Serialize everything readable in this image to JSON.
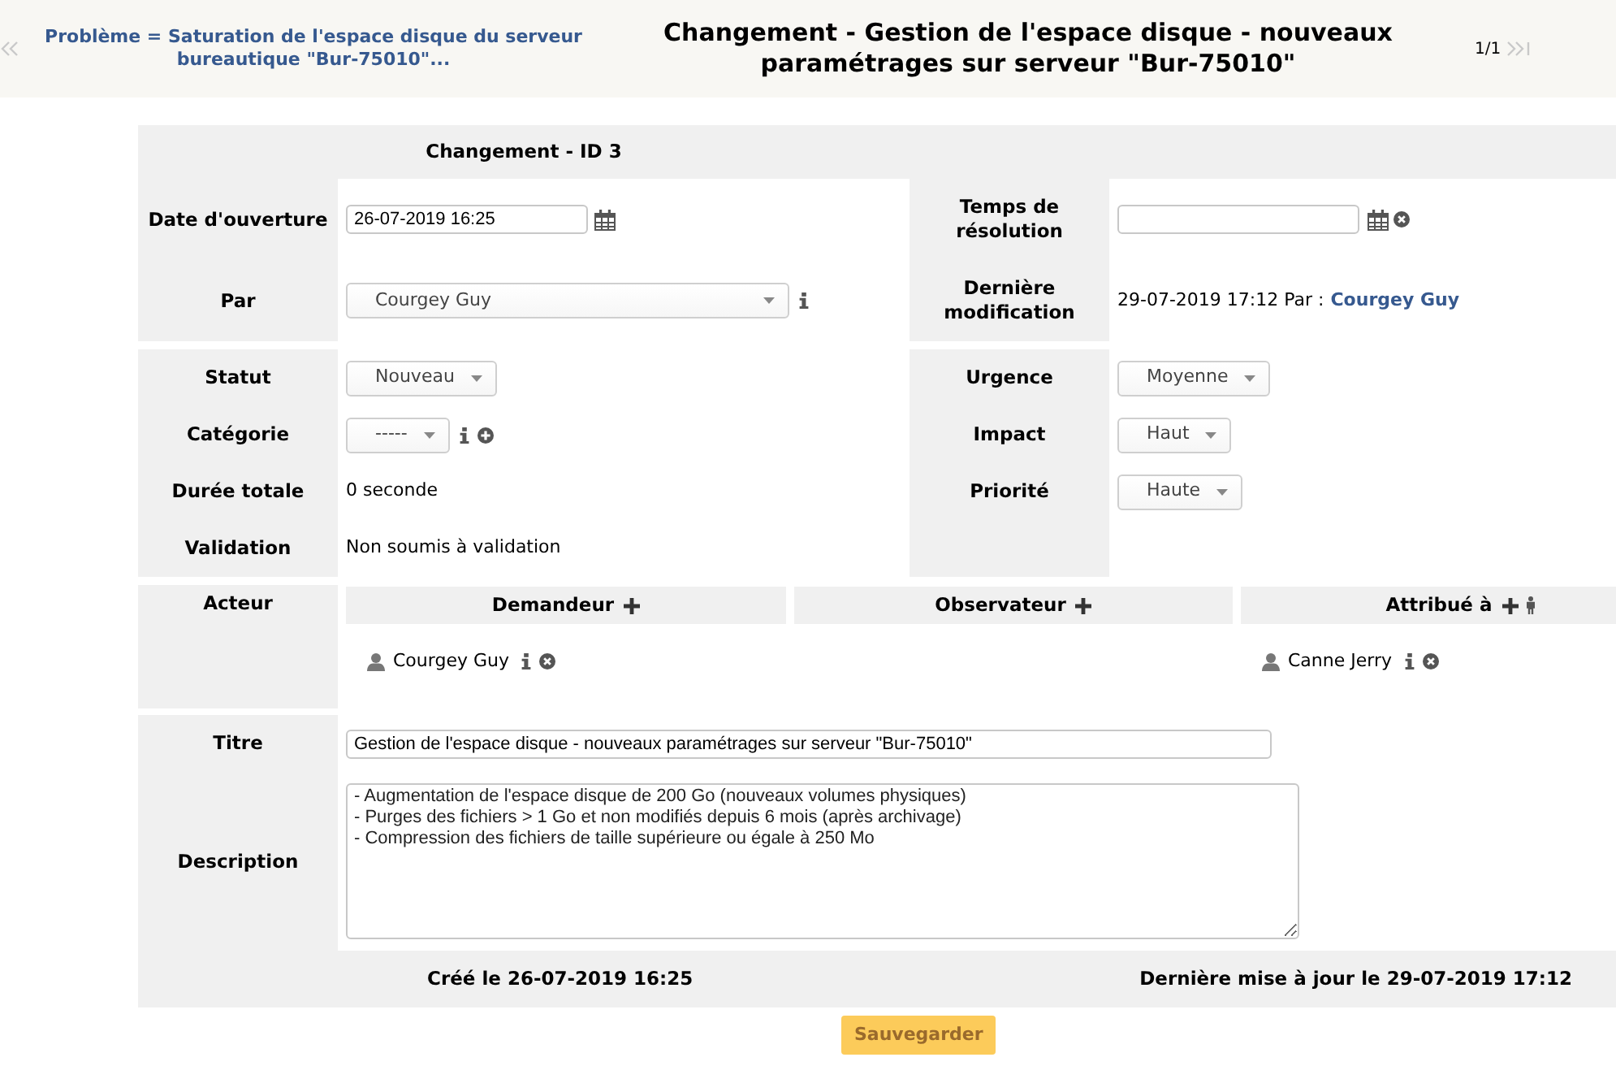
{
  "header": {
    "parent_link": "Problème = Saturation de l'espace disque du serveur bureautique \"Bur-75010\"...",
    "title": "Changement - Gestion de l'espace disque - nouveaux paramétrages sur serveur \"Bur-75010\"",
    "pager": "1/1"
  },
  "form": {
    "heading": "Changement - ID 3",
    "opening_date": {
      "label": "Date d'ouverture",
      "value": "26-07-2019 16:25"
    },
    "resolution_time": {
      "label": "Temps de résolution"
    },
    "opened_by": {
      "label": "Par",
      "value": "Courgey Guy"
    },
    "last_modification": {
      "label": "Dernière modification",
      "date": "29-07-2019 17:12 Par :",
      "user": "Courgey Guy"
    },
    "left_fields": [
      {
        "kind": "select",
        "label": "Statut",
        "value": "Nouveau"
      },
      {
        "kind": "lookup",
        "label": "Catégorie",
        "value": "-----"
      },
      {
        "kind": "text",
        "label": "Durée totale",
        "value": "0 seconde"
      },
      {
        "kind": "text",
        "label": "Validation",
        "value": "Non soumis à validation"
      }
    ],
    "right_fields": [
      {
        "label": "Urgence",
        "value": "Moyenne"
      },
      {
        "label": "Impact",
        "value": "Haut"
      },
      {
        "label": "Priorité",
        "value": "Haute"
      }
    ],
    "actors": {
      "label": "Acteur",
      "groups": [
        {
          "kind": "requester",
          "title": "Demandeur",
          "members": [
            "Courgey Guy"
          ]
        },
        {
          "kind": "observer",
          "title": "Observateur"
        },
        {
          "kind": "assignee",
          "title": "Attribué à",
          "members": [
            "Canne Jerry"
          ]
        }
      ]
    },
    "title_field": {
      "label": "Titre",
      "value": "Gestion de l'espace disque - nouveaux paramétrages sur serveur \"Bur-75010\""
    },
    "description": {
      "label": "Description",
      "value": "- Augmentation de l'espace disque de 200 Go (nouveaux volumes physiques)\n- Purges des fichiers > 1 Go et non modifiés depuis 6 mois (après archivage)\n- Compression des fichiers de taille supérieure ou égale à 250 Mo"
    },
    "footer": {
      "created": "Créé le 26-07-2019 16:25",
      "updated": "Dernière mise à jour le 29-07-2019 17:12"
    },
    "save_button": "Sauvegarder"
  }
}
